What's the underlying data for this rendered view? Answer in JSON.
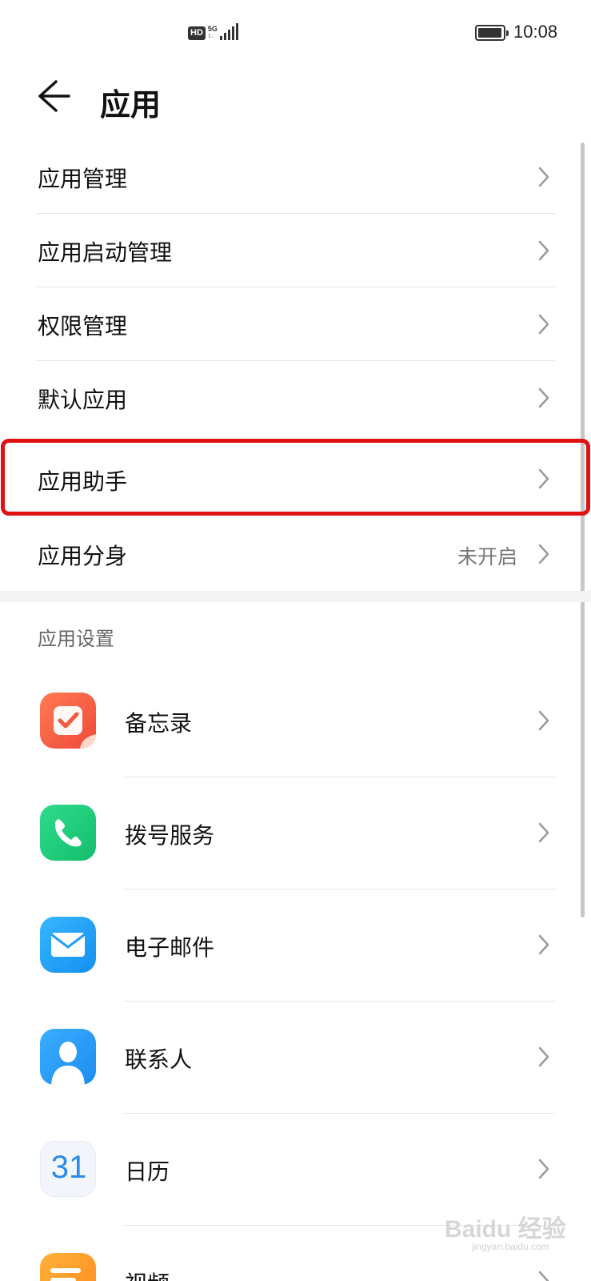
{
  "status_bar": {
    "hd_badge": "HD",
    "network": "5G",
    "network_sub": "1↓",
    "battery_level": 0.95,
    "time": "10:08"
  },
  "header": {
    "back_icon": "arrow-left-icon",
    "title": "应用"
  },
  "menu": [
    {
      "label": "应用管理",
      "value": ""
    },
    {
      "label": "应用启动管理",
      "value": ""
    },
    {
      "label": "权限管理",
      "value": ""
    },
    {
      "label": "默认应用",
      "value": ""
    },
    {
      "label": "应用助手",
      "value": "",
      "highlighted": true
    },
    {
      "label": "应用分身",
      "value": "未开启"
    }
  ],
  "highlight_color": "#e11111",
  "section_title": "应用设置",
  "apps": [
    {
      "label": "备忘录",
      "icon": "notes-icon",
      "color": "#f05a3e"
    },
    {
      "label": "拨号服务",
      "icon": "phone-icon",
      "color": "#1fc978"
    },
    {
      "label": "电子邮件",
      "icon": "mail-icon",
      "color": "#1f9ff5"
    },
    {
      "label": "联系人",
      "icon": "contacts-icon",
      "color": "#2596f2"
    },
    {
      "label": "日历",
      "icon": "calendar-icon",
      "icon_text": "31",
      "color": "#2a8ce8"
    },
    {
      "label": "视频",
      "icon": "video-icon",
      "color": "#ff9a26"
    }
  ],
  "watermark": {
    "text": "Baidu 经验",
    "sub": "jingyan.baidu.com"
  }
}
